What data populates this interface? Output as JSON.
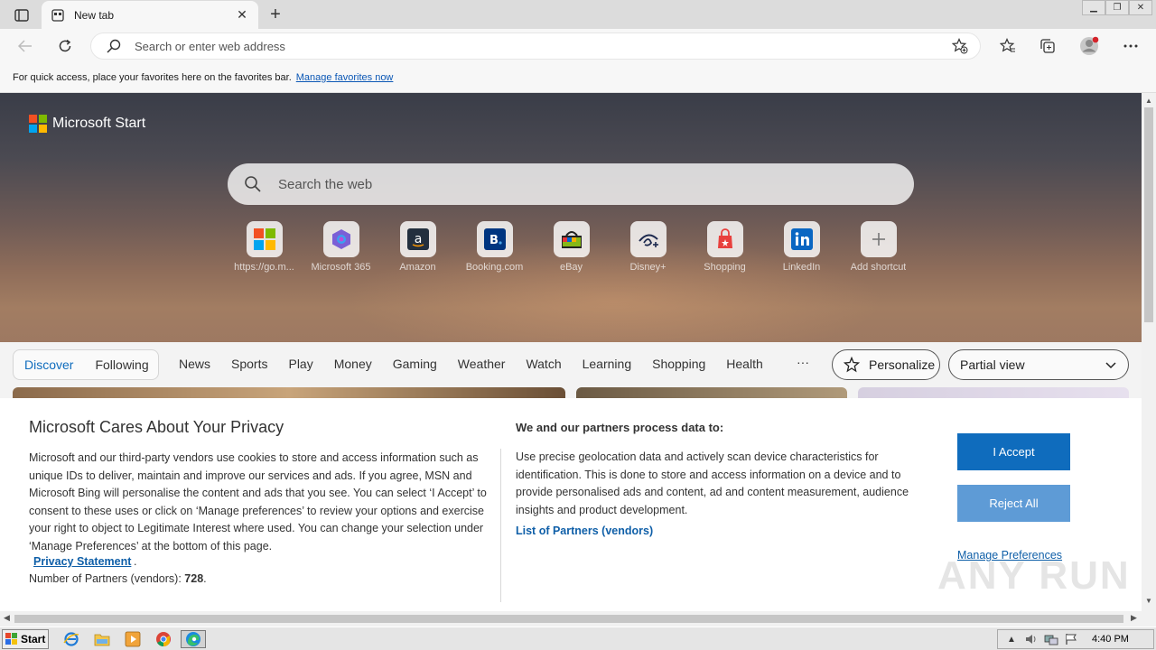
{
  "browser": {
    "tab": {
      "title": "New tab"
    },
    "omnibox": {
      "placeholder": "Search or enter web address"
    },
    "favorites_bar": {
      "message": "For quick access, place your favorites here on the favorites bar.",
      "link": "Manage favorites now"
    }
  },
  "page": {
    "brand": "Microsoft Start",
    "search_placeholder": "Search the web",
    "shortcuts": [
      {
        "label": "https://go.m...",
        "icon": "microsoft-icon"
      },
      {
        "label": "Microsoft 365",
        "icon": "m365-icon"
      },
      {
        "label": "Amazon",
        "icon": "amazon-icon"
      },
      {
        "label": "Booking.com",
        "icon": "booking-icon"
      },
      {
        "label": "eBay",
        "icon": "ebay-icon"
      },
      {
        "label": "Disney+",
        "icon": "disney-icon"
      },
      {
        "label": "Shopping",
        "icon": "shopping-bag-icon"
      },
      {
        "label": "LinkedIn",
        "icon": "linkedin-icon"
      },
      {
        "label": "Add shortcut",
        "icon": "plus-icon"
      }
    ],
    "feed": {
      "toggle": [
        "Discover",
        "Following"
      ],
      "categories": [
        "News",
        "Sports",
        "Play",
        "Money",
        "Gaming",
        "Weather",
        "Watch",
        "Learning",
        "Shopping",
        "Health"
      ],
      "more": "···",
      "personalize": "Personalize",
      "view": "Partial view"
    }
  },
  "privacy": {
    "title": "Microsoft Cares About Your Privacy",
    "body": "Microsoft and our third-party vendors use cookies to store and access information such as unique IDs to deliver, maintain and improve our services and ads. If you agree, MSN and Microsoft Bing will personalise the content and ads that you see. You can select ‘I Accept’ to consent to these uses or click on ‘Manage preferences’ to review your options and exercise your right to object to Legitimate Interest where used.  You can change your selection under ‘Manage Preferences’ at the bottom of this page.",
    "statement_link": "Privacy Statement",
    "statement_dot": ".",
    "partners_label": "Number of Partners (vendors):",
    "partners_count": "728",
    "partners_end": ".",
    "purposes_title": "We and our partners process data to:",
    "purposes_body": "Use precise geolocation data and actively scan device characteristics for identification. This is done to store and access information on a device and to provide personalised ads and content, ad and content measurement, audience insights and product development.",
    "vendors_link": "List of Partners (vendors)",
    "accept": "I Accept",
    "reject": "Reject All",
    "manage": "Manage Preferences",
    "watermark": "ANY RUN"
  },
  "taskbar": {
    "start": "Start",
    "clock": "4:40 PM"
  },
  "colors": {
    "accent": "#0f6cbd",
    "reject": "#5e9bd6",
    "link": "#0f5fa8"
  }
}
